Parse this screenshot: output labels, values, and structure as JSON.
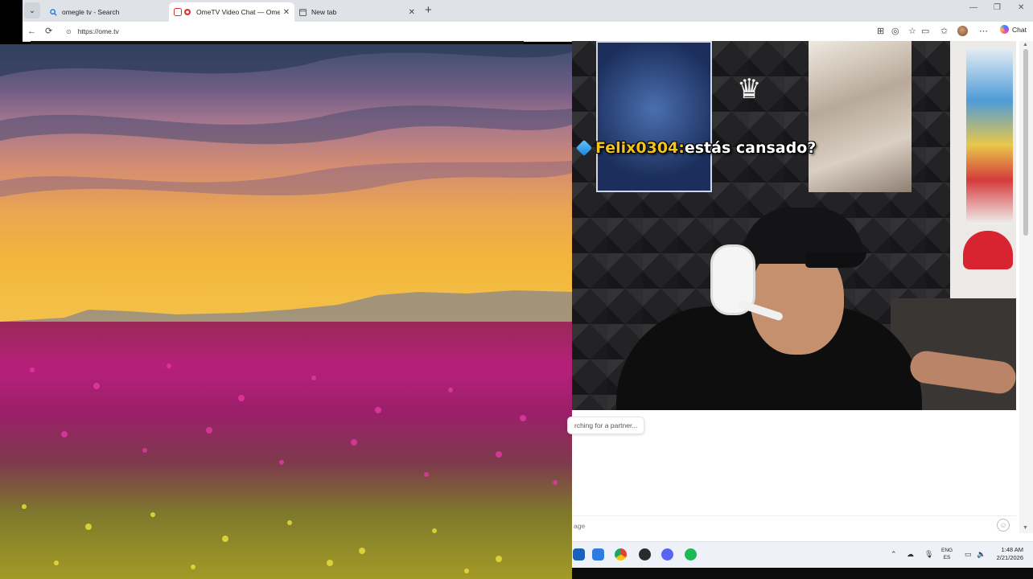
{
  "browser": {
    "tabs": [
      {
        "title": "omegle tv - Search",
        "icon": "search-icon",
        "active": false
      },
      {
        "title": "OmeTV Video Chat — Omegle",
        "icon": "recording-icon",
        "active": true
      },
      {
        "title": "New tab",
        "icon": "newtab-page-icon",
        "active": false
      }
    ],
    "tab_close": "✕",
    "new_tab": "+",
    "url": "https://ome.tv",
    "chat_label": "Chat",
    "window_controls": {
      "minimize": "—",
      "restore": "❐",
      "close": "✕"
    }
  },
  "stranger": {
    "overlay_username": "Felix0304:",
    "overlay_message": " estás cansado?"
  },
  "chat": {
    "status": "rching for a partner...",
    "input_placeholder": "age"
  },
  "taskbar": {
    "apps": [
      {
        "name": "store-app-icon",
        "color": "#1c5fb8"
      },
      {
        "name": "photos-app-icon",
        "color": "#2f7be0"
      },
      {
        "name": "chrome-app-icon",
        "color": "#e34133"
      },
      {
        "name": "obs-app-icon",
        "color": "#2b2b2b"
      },
      {
        "name": "discord-app-icon",
        "color": "#5865f2"
      },
      {
        "name": "spotify-app-icon",
        "color": "#1db954"
      }
    ],
    "lang_top": "ENG",
    "lang_bottom": "ES",
    "time": "1:48 AM",
    "date": "2/21/2026"
  }
}
